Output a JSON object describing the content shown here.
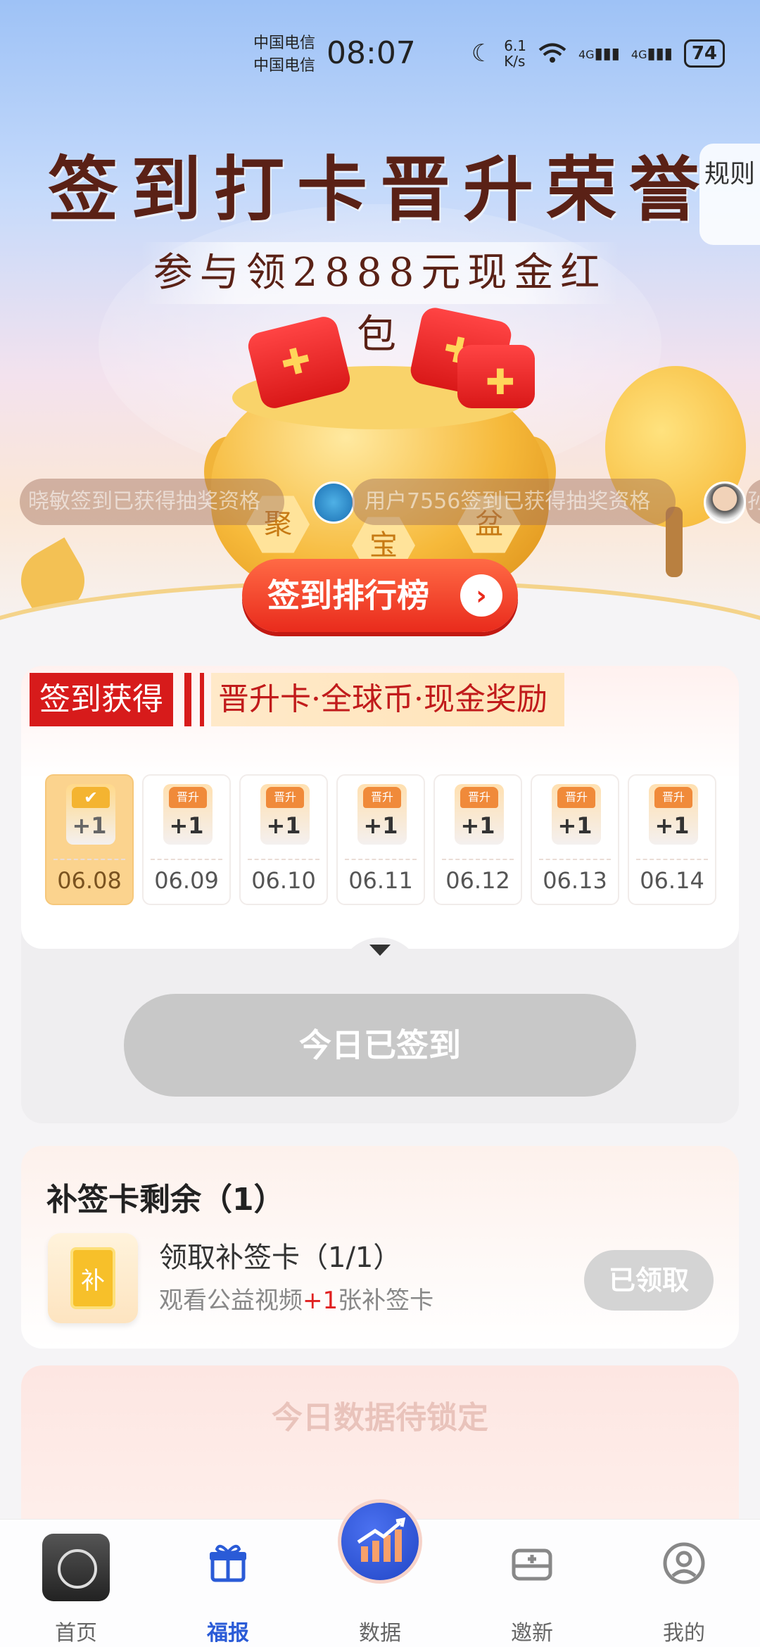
{
  "status_bar": {
    "carrier_1": "中国电信",
    "carrier_2": "中国电信",
    "time": "08:07",
    "net_speed": "6.1\nK/s",
    "signal_1": "4G",
    "signal_2": "4G",
    "battery": "74"
  },
  "hero": {
    "title": "签到打卡晋升荣誉",
    "subtitle": "参与领2888元现金红包",
    "rules_btn": "规则",
    "pot_chars": [
      "聚",
      "宝",
      "盆"
    ],
    "ticker": [
      {
        "text": "晓敏签到已获得抽奖资格"
      },
      {
        "text": "用户7556签到已获得抽奖资格"
      },
      {
        "text": "孙"
      }
    ],
    "rank_btn": "签到排行榜"
  },
  "signin": {
    "earn_label": "签到获得",
    "earn_desc": "晋升卡·全球币·现金奖励",
    "days": [
      {
        "date": "06.08",
        "reward": "+1",
        "card_mark": "✔",
        "active": true
      },
      {
        "date": "06.09",
        "reward": "+1",
        "card_mark": "晋升",
        "active": false
      },
      {
        "date": "06.10",
        "reward": "+1",
        "card_mark": "晋升",
        "active": false
      },
      {
        "date": "06.11",
        "reward": "+1",
        "card_mark": "晋升",
        "active": false
      },
      {
        "date": "06.12",
        "reward": "+1",
        "card_mark": "晋升",
        "active": false
      },
      {
        "date": "06.13",
        "reward": "+1",
        "card_mark": "晋升",
        "active": false
      },
      {
        "date": "06.14",
        "reward": "+1",
        "card_mark": "晋升",
        "active": false
      }
    ],
    "signed_btn": "今日已签到"
  },
  "makeup": {
    "title": "补签卡剩余（1）",
    "icon_char": "补",
    "item_name": "领取补签卡（1/1）",
    "desc_pre": "观看公益视频",
    "desc_hl": "+1",
    "desc_post": "张补签卡",
    "claimed_btn": "已领取"
  },
  "data_card": {
    "title": "今日数据待锁定"
  },
  "bottom_nav": [
    {
      "label": "首页"
    },
    {
      "label": "福报"
    },
    {
      "label": "数据"
    },
    {
      "label": "邀新"
    },
    {
      "label": "我的"
    }
  ],
  "colors": {
    "brand_red": "#d71b1b",
    "nav_active": "#2a5bd7",
    "disabled_btn": "#c8c8c8"
  }
}
